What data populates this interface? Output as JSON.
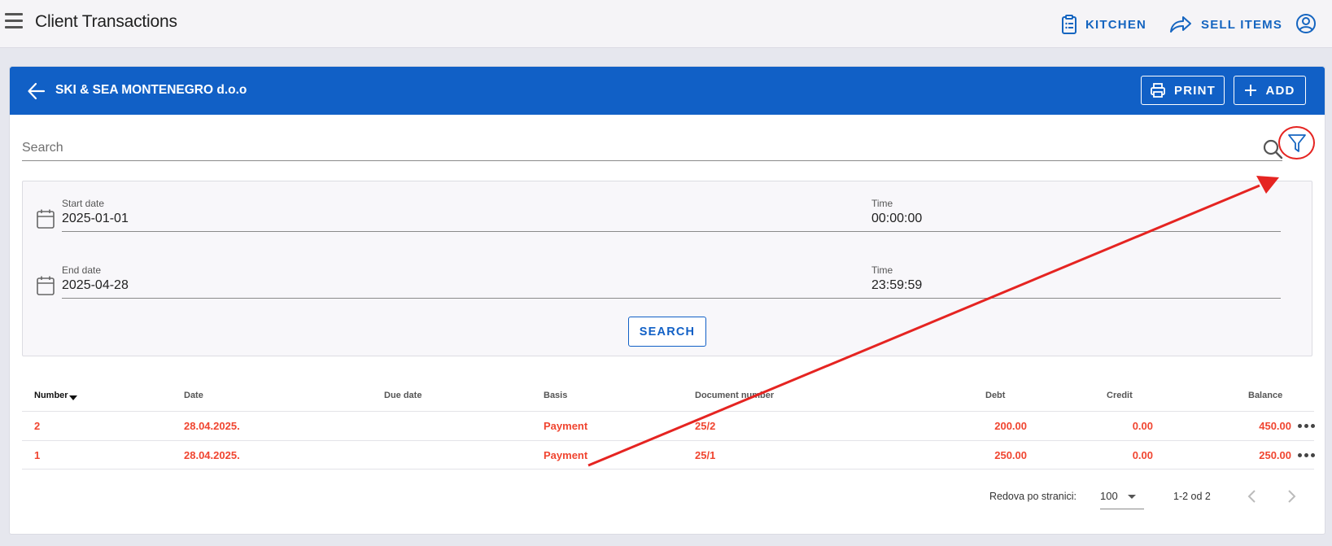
{
  "topbar": {
    "title": "Client Transactions",
    "kitchen_label": "KITCHEN",
    "sell_label": "SELL ITEMS"
  },
  "client": {
    "name": "SKI & SEA MONTENEGRO d.o.o",
    "print_label": "PRINT",
    "add_label": "ADD"
  },
  "search": {
    "placeholder": "Search",
    "value": ""
  },
  "filters": {
    "start_date_label": "Start date",
    "start_date": "2025-01-01",
    "start_time_label": "Time",
    "start_time": "00:00:00",
    "end_date_label": "End date",
    "end_date": "2025-04-28",
    "end_time_label": "Time",
    "end_time": "23:59:59",
    "search_button": "SEARCH"
  },
  "table": {
    "headers": {
      "number": "Number",
      "date": "Date",
      "due_date": "Due date",
      "basis": "Basis",
      "document_number": "Document number",
      "debt": "Debt",
      "credit": "Credit",
      "balance": "Balance"
    },
    "rows": [
      {
        "number": "2",
        "date": "28.04.2025.",
        "due_date": "",
        "basis": "Payment",
        "document_number": "25/2",
        "debt": "200.00",
        "credit": "0.00",
        "balance": "450.00"
      },
      {
        "number": "1",
        "date": "28.04.2025.",
        "due_date": "",
        "basis": "Payment",
        "document_number": "25/1",
        "debt": "250.00",
        "credit": "0.00",
        "balance": "250.00"
      }
    ],
    "row_text_color": "#f04530"
  },
  "pagination": {
    "rows_per_page_label": "Redova po stranici:",
    "rows_per_page": "100",
    "range": "1-2 od 2"
  },
  "colors": {
    "primary": "#1160c6",
    "annotation": "#e52421"
  },
  "icons": {
    "menu": "hamburger-menu-icon",
    "kitchen": "clipboard-list-icon",
    "sell": "share-forward-icon",
    "account": "account-circle-icon",
    "back": "arrow-left-icon",
    "print": "printer-icon",
    "add": "plus-icon",
    "search": "search-icon",
    "filter": "funnel-filter-icon",
    "calendar": "calendar-icon",
    "more": "more-horizontal-icon",
    "prev": "chevron-left-icon",
    "next": "chevron-right-icon"
  }
}
